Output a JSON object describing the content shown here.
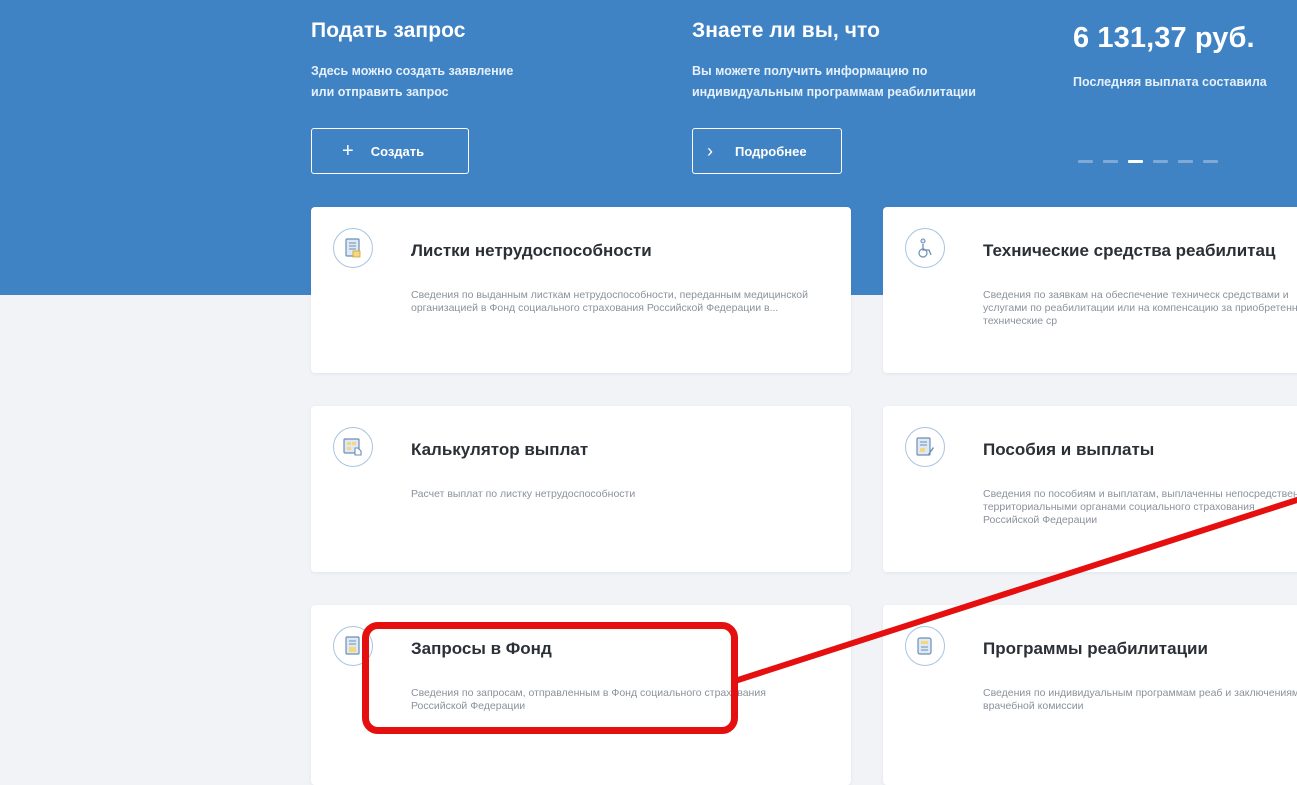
{
  "banner": {
    "promo_request": {
      "title": "Подать запрос",
      "text_line1": "Здесь можно создать заявление",
      "text_line2": "или отправить запрос",
      "button_label": "Создать",
      "button_icon": "plus-icon"
    },
    "promo_info": {
      "title": "Знаете ли вы, что",
      "text_line1": "Вы можете получить информацию по",
      "text_line2": "индивидуальным программам реабилитации",
      "button_label": "Подробнее",
      "button_icon": "chevron-right-icon"
    },
    "promo_payment": {
      "title": "6 131,37 руб.",
      "text": "Последняя выплата составила"
    },
    "carousel": {
      "total": 6,
      "active_index": 2
    }
  },
  "cards": {
    "sick_leave": {
      "title": "Листки нетрудоспособности",
      "description": "Сведения по выданным листкам нетрудоспособности, переданным медицинской организацией в Фонд социального страхования Российской Федерации в...",
      "icon": "document-icon"
    },
    "rehab_means": {
      "title": "Технические средства реабилитац",
      "description": "Сведения по заявкам на обеспечение техническ средствами и услугами по реабилитации или на компенсацию за приобретенные технические ср",
      "icon": "wheelchair-icon"
    },
    "calculator": {
      "title": "Калькулятор выплат",
      "description": "Расчет выплат по листку нетрудоспособности",
      "icon": "calculator-icon"
    },
    "benefits": {
      "title": "Пособия и выплаты",
      "description": "Сведения по пособиям и выплатам, выплаченны непосредственно территориальными органами социального страхования Российской Федерации",
      "icon": "document-edit-icon"
    },
    "requests": {
      "title": "Запросы в Фонд",
      "description": "Сведения по запросам, отправленным в Фонд социального страхования Российской Федерации",
      "icon": "request-document-icon"
    },
    "rehab_programs": {
      "title": "Программы реабилитации",
      "description": "Сведения по индивидуальным программам реаб и заключениям врачебной комиссии",
      "icon": "scroll-icon"
    }
  },
  "colors": {
    "banner": "#3f83c5",
    "page_background": "#f1f3f7",
    "highlight": "#e60f0f",
    "icon_stroke": "#a9c4df"
  }
}
